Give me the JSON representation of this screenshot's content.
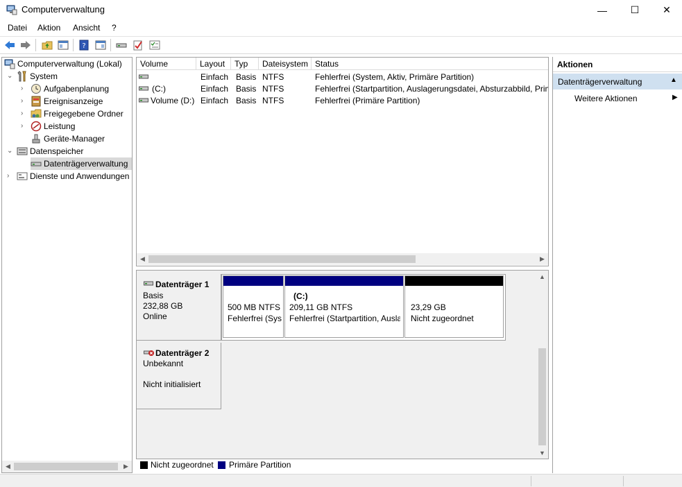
{
  "window": {
    "title": "Computerverwaltung",
    "min_glyph": "—",
    "max_glyph": "☐",
    "close_glyph": "✕"
  },
  "menu": [
    "Datei",
    "Aktion",
    "Ansicht",
    "?"
  ],
  "toolbar": {
    "icons": [
      "back-icon",
      "forward-icon",
      "up-folder-icon",
      "show-hide-tree-icon",
      "help-icon",
      "properties-pane-icon",
      "disk-icon",
      "checklist-icon",
      "list-icon"
    ]
  },
  "tree": {
    "root": "Computerverwaltung (Lokal)",
    "system": "System",
    "system_children": [
      "Aufgabenplanung",
      "Ereignisanzeige",
      "Freigegebene Ordner",
      "Leistung",
      "Geräte-Manager"
    ],
    "storage": "Datenspeicher",
    "storage_children": [
      "Datenträgerverwaltung"
    ],
    "services": "Dienste und Anwendungen"
  },
  "volumes": {
    "columns": [
      "Volume",
      "Layout",
      "Typ",
      "Dateisystem",
      "Status"
    ],
    "rows": [
      [
        "",
        "Einfach",
        "Basis",
        "NTFS",
        "Fehlerfrei (System, Aktiv, Primäre Partition)"
      ],
      [
        "(C:)",
        "Einfach",
        "Basis",
        "NTFS",
        "Fehlerfrei (Startpartition, Auslagerungsdatei, Absturzabbild, Prim"
      ],
      [
        "Volume (D:)",
        "Einfach",
        "Basis",
        "NTFS",
        "Fehlerfrei (Primäre Partition)"
      ]
    ]
  },
  "disks": {
    "disk1": {
      "name": "Datenträger 1",
      "type": "Basis",
      "size": "232,88 GB",
      "state": "Online",
      "partitions": [
        {
          "label": "",
          "size": "500 MB NTFS",
          "status": "Fehlerfrei (Sys",
          "kind": "primary"
        },
        {
          "label": "(C:)",
          "size": "209,11 GB NTFS",
          "status": "Fehlerfrei (Startpartition, Ausla",
          "kind": "primary"
        },
        {
          "label": "",
          "size": "23,29 GB",
          "status": "Nicht zugeordnet",
          "kind": "unallocated"
        }
      ]
    },
    "disk2": {
      "name": "Datenträger 2",
      "type": "Unbekannt",
      "state": "Nicht initialisiert"
    }
  },
  "legend": {
    "unallocated": "Nicht zugeordnet",
    "primary": "Primäre Partition"
  },
  "colors": {
    "primary": "#000080",
    "unallocated": "#000000",
    "action_header_bg": "#cfe0f0"
  },
  "actions": {
    "header": "Aktionen",
    "section": "Datenträgerverwaltung",
    "items": [
      "Weitere Aktionen"
    ]
  }
}
